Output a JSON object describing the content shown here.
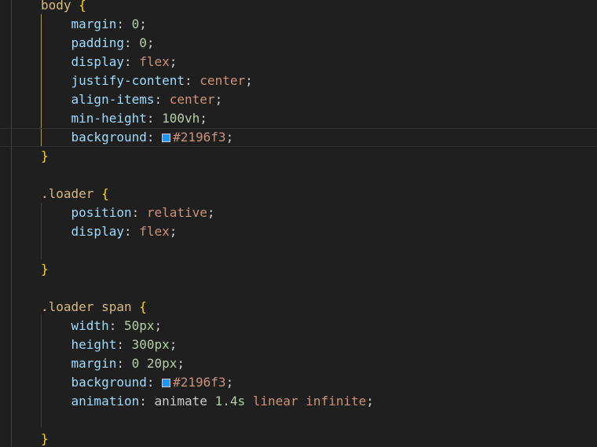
{
  "colors": {
    "editor_bg": "#1f1f1f",
    "default": "#cccccc",
    "selector": "#d7ba7d",
    "property": "#9cdcfe",
    "string_value": "#ce9178",
    "number": "#b5cea8",
    "brace": "#ffd700",
    "active_guide": "#b89a3a"
  },
  "lines": [
    {
      "tokens": [
        {
          "t": "body ",
          "k": "selector"
        },
        {
          "t": "{",
          "k": "brace"
        }
      ]
    },
    {
      "tokens": [
        {
          "t": "    "
        },
        {
          "t": "margin",
          "k": "property"
        },
        {
          "t": ": "
        },
        {
          "t": "0",
          "k": "number"
        },
        {
          "t": ";"
        }
      ]
    },
    {
      "tokens": [
        {
          "t": "    "
        },
        {
          "t": "padding",
          "k": "property"
        },
        {
          "t": ": "
        },
        {
          "t": "0",
          "k": "number"
        },
        {
          "t": ";"
        }
      ]
    },
    {
      "tokens": [
        {
          "t": "    "
        },
        {
          "t": "display",
          "k": "property"
        },
        {
          "t": ": "
        },
        {
          "t": "flex",
          "k": "string_value"
        },
        {
          "t": ";"
        }
      ]
    },
    {
      "tokens": [
        {
          "t": "    "
        },
        {
          "t": "justify-content",
          "k": "property"
        },
        {
          "t": ": "
        },
        {
          "t": "center",
          "k": "string_value"
        },
        {
          "t": ";"
        }
      ]
    },
    {
      "tokens": [
        {
          "t": "    "
        },
        {
          "t": "align-items",
          "k": "property"
        },
        {
          "t": ": "
        },
        {
          "t": "center",
          "k": "string_value"
        },
        {
          "t": ";"
        }
      ]
    },
    {
      "tokens": [
        {
          "t": "    "
        },
        {
          "t": "min-height",
          "k": "property"
        },
        {
          "t": ": "
        },
        {
          "t": "100vh",
          "k": "number"
        },
        {
          "t": ";"
        }
      ]
    },
    {
      "current": true,
      "tokens": [
        {
          "t": "    "
        },
        {
          "t": "background",
          "k": "property"
        },
        {
          "t": ": "
        },
        {
          "swatch": "#2196f3"
        },
        {
          "t": "#2196f3",
          "k": "string_value"
        },
        {
          "t": ";"
        }
      ]
    },
    {
      "tokens": [
        {
          "t": "}",
          "k": "brace"
        }
      ]
    },
    {
      "tokens": []
    },
    {
      "tokens": [
        {
          "t": ".loader ",
          "k": "selector"
        },
        {
          "t": "{",
          "k": "brace"
        }
      ]
    },
    {
      "tokens": [
        {
          "t": "    "
        },
        {
          "t": "position",
          "k": "property"
        },
        {
          "t": ": "
        },
        {
          "t": "relative",
          "k": "string_value"
        },
        {
          "t": ";"
        }
      ]
    },
    {
      "tokens": [
        {
          "t": "    "
        },
        {
          "t": "display",
          "k": "property"
        },
        {
          "t": ": "
        },
        {
          "t": "flex",
          "k": "string_value"
        },
        {
          "t": ";"
        }
      ]
    },
    {
      "tokens": []
    },
    {
      "tokens": [
        {
          "t": "}",
          "k": "brace"
        }
      ]
    },
    {
      "tokens": []
    },
    {
      "tokens": [
        {
          "t": ".loader span ",
          "k": "selector"
        },
        {
          "t": "{",
          "k": "brace"
        }
      ]
    },
    {
      "tokens": [
        {
          "t": "    "
        },
        {
          "t": "width",
          "k": "property"
        },
        {
          "t": ": "
        },
        {
          "t": "50px",
          "k": "number"
        },
        {
          "t": ";"
        }
      ]
    },
    {
      "tokens": [
        {
          "t": "    "
        },
        {
          "t": "height",
          "k": "property"
        },
        {
          "t": ": "
        },
        {
          "t": "300px",
          "k": "number"
        },
        {
          "t": ";"
        }
      ]
    },
    {
      "tokens": [
        {
          "t": "    "
        },
        {
          "t": "margin",
          "k": "property"
        },
        {
          "t": ": "
        },
        {
          "t": "0 20px",
          "k": "number"
        },
        {
          "t": ";"
        }
      ]
    },
    {
      "tokens": [
        {
          "t": "    "
        },
        {
          "t": "background",
          "k": "property"
        },
        {
          "t": ": "
        },
        {
          "swatch": "#2196f3"
        },
        {
          "t": "#2196f3",
          "k": "string_value"
        },
        {
          "t": ";"
        }
      ]
    },
    {
      "tokens": [
        {
          "t": "    "
        },
        {
          "t": "animation",
          "k": "property"
        },
        {
          "t": ": "
        },
        {
          "t": "animate "
        },
        {
          "t": "1.4s",
          "k": "number"
        },
        {
          "t": " "
        },
        {
          "t": "linear",
          "k": "string_value"
        },
        {
          "t": " "
        },
        {
          "t": "infinite",
          "k": "string_value"
        },
        {
          "t": ";"
        }
      ]
    },
    {
      "tokens": []
    },
    {
      "tokens": [
        {
          "t": "}",
          "k": "brace"
        }
      ]
    }
  ]
}
